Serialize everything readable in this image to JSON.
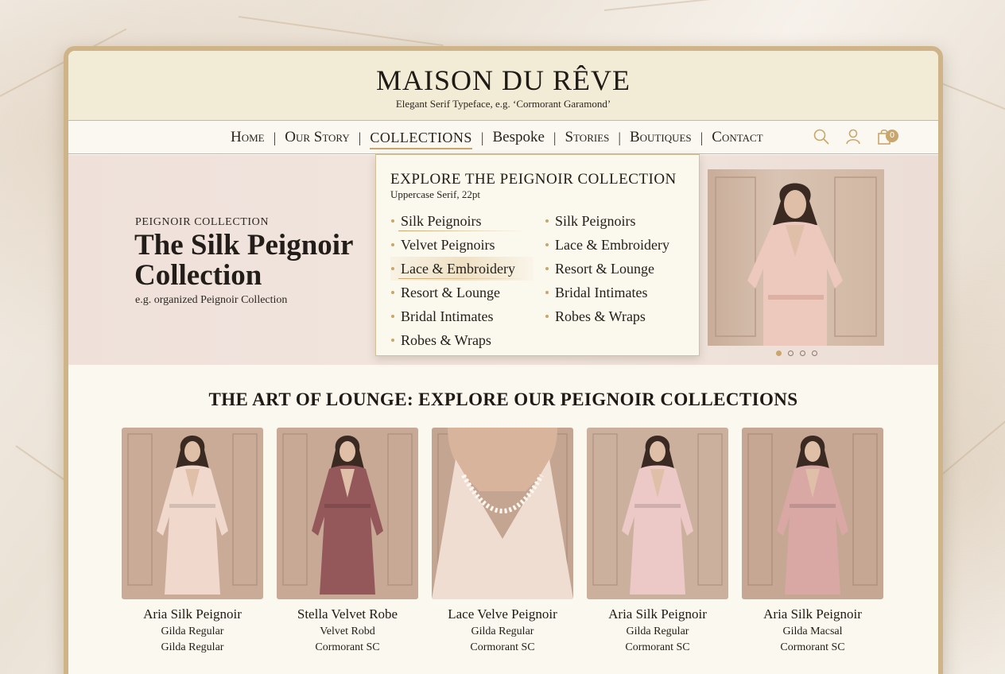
{
  "brand": {
    "name": "MAISON DU RÊVE",
    "tagline": "Elegant Serif Typeface, e.g. ‘Cormorant Garamond’"
  },
  "nav": {
    "items": [
      {
        "label": "Home",
        "style": "smallcaps"
      },
      {
        "label": "Our Story",
        "style": "smallcaps"
      },
      {
        "label": "COLLECTIONS",
        "style": "upper",
        "active": true
      },
      {
        "label": "Bespoke",
        "style": "normal"
      },
      {
        "label": "Stories",
        "style": "smallcaps"
      },
      {
        "label": "Boutiques",
        "style": "smallcaps"
      },
      {
        "label": "Contact",
        "style": "smallcaps"
      }
    ],
    "icons": [
      "search-icon",
      "user-icon",
      "shopping-bag-icon"
    ],
    "cart_count": "0"
  },
  "hero": {
    "eyebrow": "PEIGNOIR COLLECTION",
    "title": "The Silk Peignoir Collection",
    "subtitle": "e.g. organized Peignoir Collection",
    "slides": 4,
    "active_slide": 1
  },
  "dropdown": {
    "title": "EXPLORE THE PEIGNOIR COLLECTION",
    "subtitle": "Uppercase Serif, 22pt",
    "column_1": [
      "Silk Peignoirs",
      "Velvet Peignoirs",
      "Lace & Embroidery",
      "Resort & Lounge",
      "Bridal Intimates",
      "Robes & Wraps"
    ],
    "column_2": [
      "Silk Peignoirs",
      "Lace & Embroidery",
      "Resort & Lounge",
      "Bridal Intimates",
      "Robes & Wraps"
    ]
  },
  "section": {
    "title": "THE ART OF LOUNGE: EXPLORE OUR PEIGNOIR COLLECTIONS"
  },
  "products": [
    {
      "name": "Aria Silk Peignoir",
      "line1": "Gilda Regular",
      "line2": "Gilda Regular",
      "garment": "#f0d8cc"
    },
    {
      "name": "Stella Velvet Robe",
      "line1": "Velvet Robd",
      "line2": "Cormorant SC",
      "garment": "#94575a"
    },
    {
      "name": "Lace Velve Peignoir",
      "line1": "Gilda Regular",
      "line2": "Cormorant SC",
      "garment": "#efddd2"
    },
    {
      "name": "Aria Silk Peignoir",
      "line1": "Gilda Regular",
      "line2": "Cormorant SC",
      "garment": "#ecc8c6"
    },
    {
      "name": "Aria Silk Peignoir",
      "line1": "Gilda Macsal",
      "line2": "Cormorant SC",
      "garment": "#d9a7a4"
    }
  ],
  "colors": {
    "gold": "#c9a66b",
    "ivory": "#fbf8ef",
    "blush": "#efe1da"
  }
}
